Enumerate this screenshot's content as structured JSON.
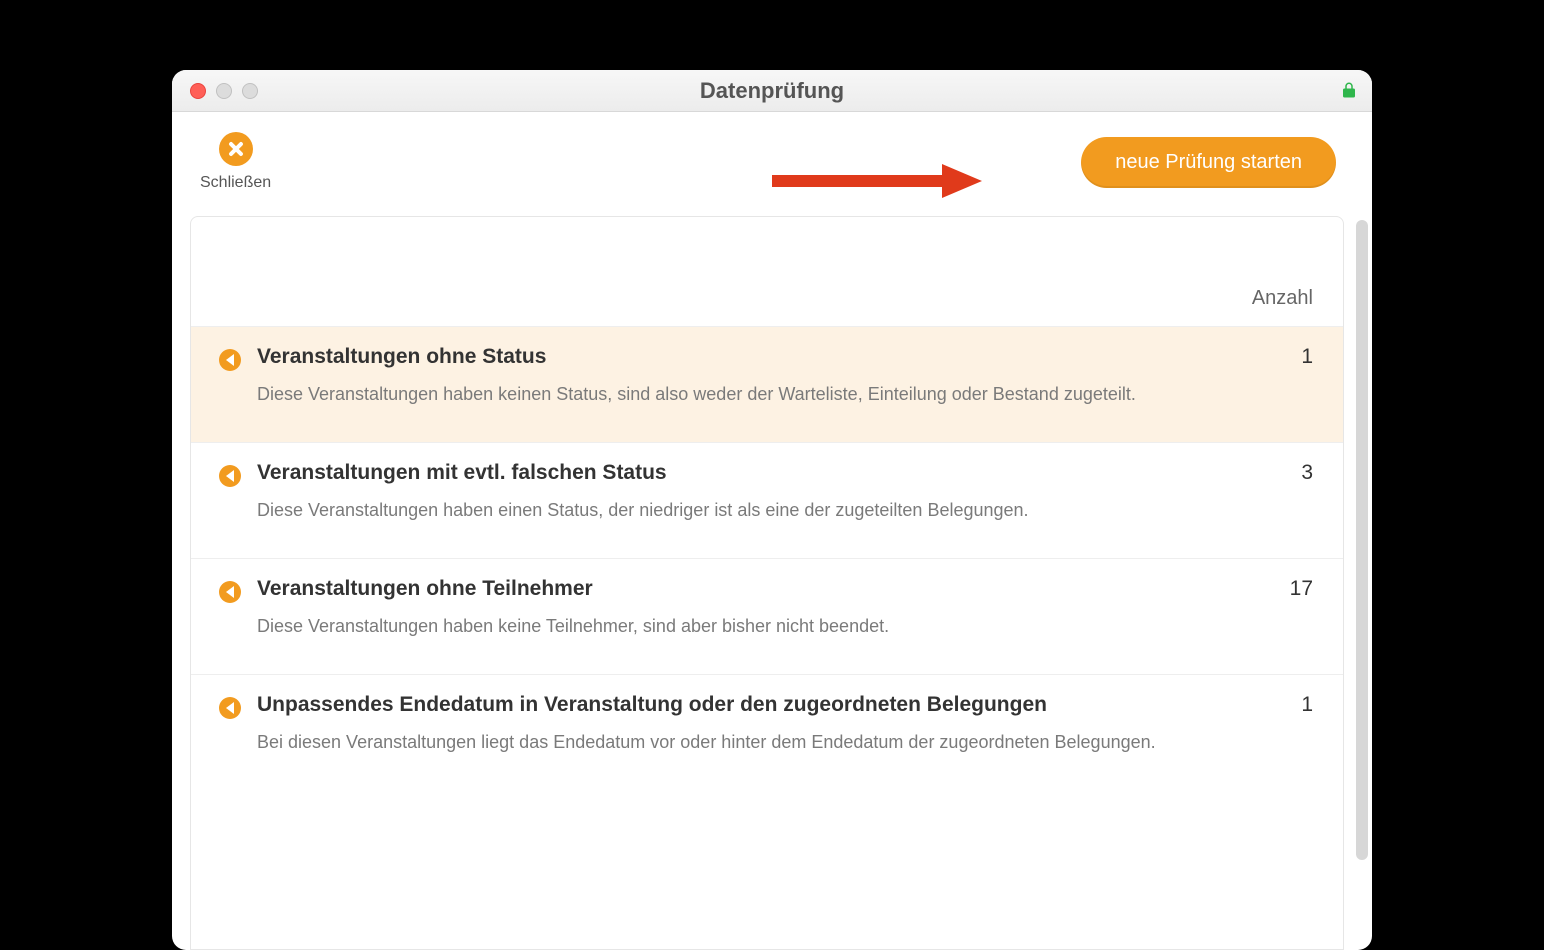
{
  "window": {
    "title": "Datenprüfung"
  },
  "toolbar": {
    "close_label": "Schließen",
    "primary_button_label": "neue Prüfung starten"
  },
  "list_header": {
    "count_label": "Anzahl"
  },
  "items": [
    {
      "title": "Veranstaltungen ohne Status",
      "count": "1",
      "description": "Diese Veranstaltungen haben keinen Status, sind also weder der Warteliste, Einteilung oder Bestand zugeteilt.",
      "selected": true
    },
    {
      "title": "Veranstaltungen mit evtl. falschen Status",
      "count": "3",
      "description": "Diese Veranstaltungen haben einen Status, der niedriger ist als eine der zugeteilten Belegungen.",
      "selected": false
    },
    {
      "title": "Veranstaltungen ohne Teilnehmer",
      "count": "17",
      "description": "Diese Veranstaltungen haben keine Teilnehmer, sind aber bisher nicht beendet.",
      "selected": false
    },
    {
      "title": "Unpassendes Endedatum in Veranstaltung oder den zugeordneten Belegungen",
      "count": "1",
      "description": "Bei diesen Veranstaltungen liegt das Endedatum vor oder hinter dem Endedatum der zugeordneten Belegungen.",
      "selected": false
    }
  ],
  "annotation": {
    "arrow_color": "#e03a1b"
  }
}
